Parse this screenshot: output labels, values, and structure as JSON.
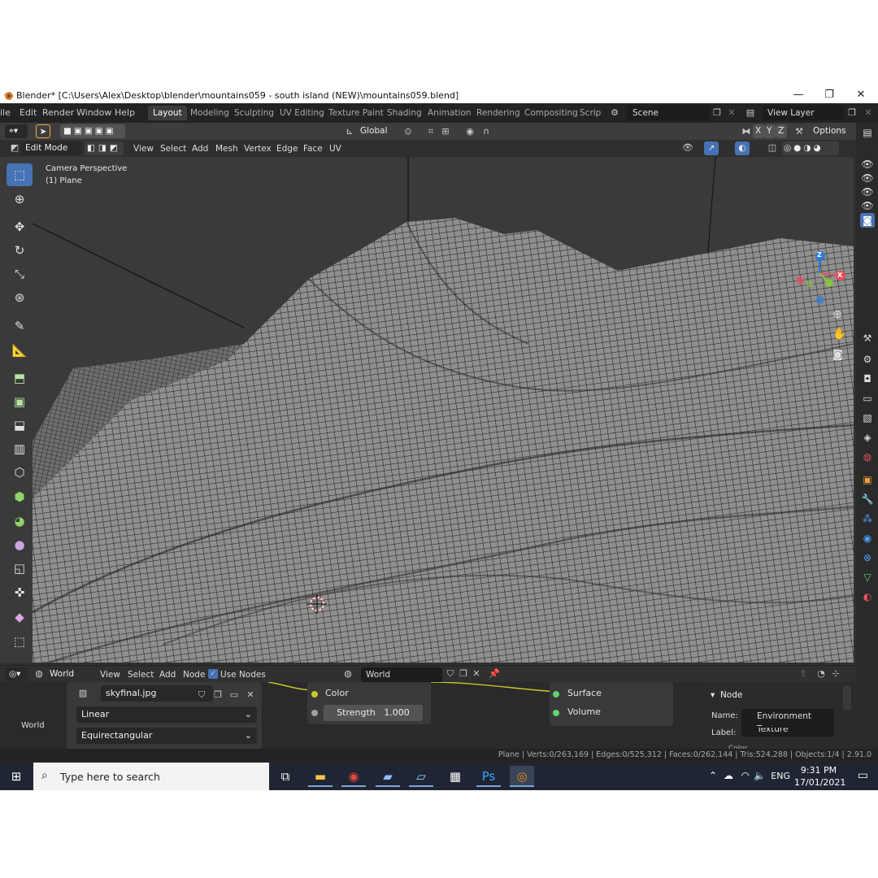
{
  "window": {
    "title": "Blender* [C:\\Users\\Alex\\Desktop\\blender\\mountains059 - south island (NEW)\\mountains059.blend]",
    "minimize": "—",
    "maximize": "❐",
    "close": "✕"
  },
  "menu": [
    "ile",
    "Edit",
    "Render",
    "Window",
    "Help"
  ],
  "workspaces": [
    "Layout",
    "Modeling",
    "Sculpting",
    "UV Editing",
    "Texture Paint",
    "Shading",
    "Animation",
    "Rendering",
    "Compositing",
    "Script"
  ],
  "scene": {
    "label": "Scene",
    "view_layer": "View Layer"
  },
  "header1": {
    "orientation": "Global",
    "axes": [
      "X",
      "Y",
      "Z"
    ],
    "options": "Options"
  },
  "header2": {
    "mode": "Edit Mode",
    "menus": [
      "View",
      "Select",
      "Add",
      "Mesh",
      "Vertex",
      "Edge",
      "Face",
      "UV"
    ]
  },
  "viewport": {
    "line1": "Camera Perspective",
    "line2": "(1) Plane",
    "gizmo": {
      "z": "Z",
      "x": "X"
    }
  },
  "node_editor": {
    "world_type": "World",
    "menus": [
      "View",
      "Select",
      "Add",
      "Node"
    ],
    "use_nodes": "Use Nodes",
    "world_name": "World",
    "image_name": "skyfinal.jpg",
    "interpolation": "Linear",
    "projection": "Equirectangular",
    "color_label": "Color",
    "strength_label": "Strength",
    "strength_value": "1.000",
    "output_surface": "Surface",
    "output_volume": "Volume",
    "panel_title": "Node",
    "name_label": "Name:",
    "name_value": "Environment Texture",
    "label_label": "Label:",
    "panel_next": "Color"
  },
  "status_bar": {
    "text": "Plane | Verts:0/263,169 | Edges:0/525,312 | Faces:0/262,144 | Tris:524,288 | Objects:1/4 | 2.91.0"
  },
  "taskbar": {
    "search_placeholder": "Type here to search",
    "lang": "ENG",
    "time": "9:31 PM",
    "date": "17/01/2021"
  },
  "colors": {
    "accent": "#4772b3",
    "background": "#303030",
    "taskbar": "#1f2532"
  }
}
